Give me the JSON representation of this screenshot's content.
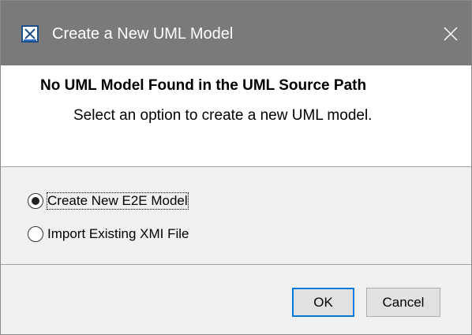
{
  "window": {
    "title": "Create a New UML Model",
    "icon": "app-icon",
    "close_icon": "close-icon"
  },
  "header": {
    "heading": "No UML Model Found in the UML Source Path",
    "description": "Select an option to create a new UML model."
  },
  "options": [
    {
      "label": "Create New E2E Model",
      "selected": true
    },
    {
      "label": "Import Existing XMI File",
      "selected": false
    }
  ],
  "buttons": {
    "ok": "OK",
    "cancel": "Cancel"
  },
  "colors": {
    "titlebar": "#7a7a7a",
    "accent": "#0078d7",
    "dialog_bg": "#f0f0f0"
  }
}
